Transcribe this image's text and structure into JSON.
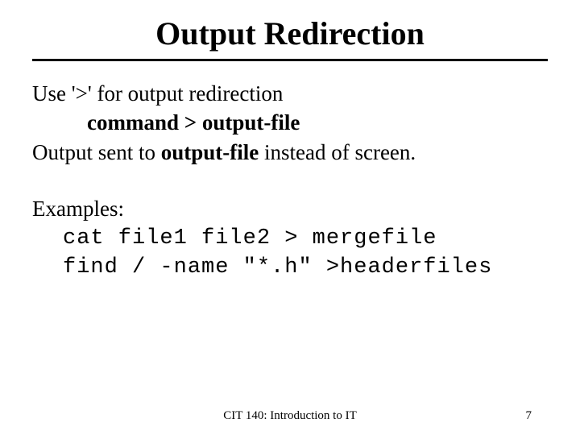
{
  "title": "Output Redirection",
  "line1_a": "Use '>' for output redirection",
  "line2_a": "command > output-file",
  "line3_a": "Output sent to ",
  "line3_b": "output-file",
  "line3_c": " instead of screen.",
  "examples_label": "Examples:",
  "code1": "cat file1 file2 > mergefile",
  "code2": "find / -name \"*.h\" >headerfiles",
  "footer_center": "CIT 140: Introduction to IT",
  "footer_page": "7"
}
